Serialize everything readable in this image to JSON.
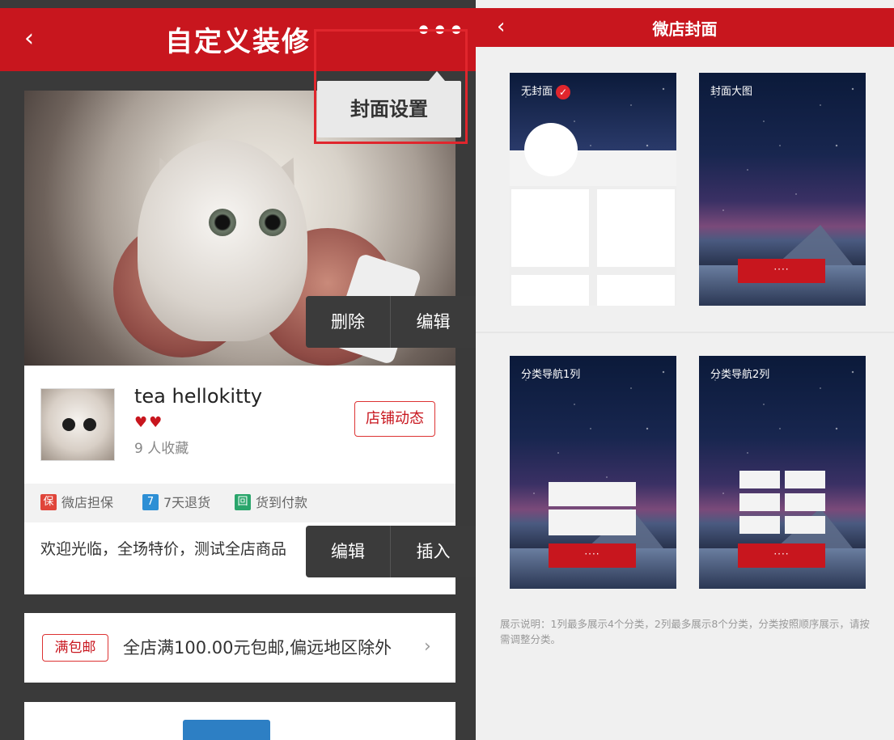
{
  "left": {
    "back_icon": "‹",
    "title": "自定义装修",
    "more_icon": "•••",
    "popup_label": "封面设置",
    "cover_actions": [
      "删除",
      "编辑"
    ],
    "shop": {
      "name": "tea hellokitty",
      "hearts": "♥♥",
      "favorites": "9 人收藏",
      "dynamic_button": "店铺动态"
    },
    "tags": [
      {
        "icon": "保",
        "label": "微店担保",
        "color": "#e0453a"
      },
      {
        "icon": "7",
        "label": "7天退货",
        "color": "#2d8fd5"
      },
      {
        "icon": "回",
        "label": "货到付款",
        "color": "#2aa56b"
      }
    ],
    "welcome": "欢迎光临，全场特价，测试全店商品",
    "desc_actions": [
      "编辑",
      "插入"
    ],
    "shipping": {
      "badge": "满包邮",
      "text": "全店满100.00元包邮,偏远地区除外",
      "chevron": "›"
    }
  },
  "right": {
    "back_icon": "‹",
    "title": "微店封面",
    "options": [
      {
        "label": "无封面",
        "selected": true
      },
      {
        "label": "封面大图",
        "selected": false,
        "button": "····"
      },
      {
        "label": "分类导航1列",
        "selected": false,
        "button": "····"
      },
      {
        "label": "分类导航2列",
        "selected": false,
        "button": "····"
      }
    ],
    "check_icon": "✓",
    "note": "展示说明：1列最多展示4个分类，2列最多展示8个分类，分类按照顺序展示，请按需调整分类。"
  },
  "colors": {
    "brand_red": "#c8161e",
    "highlight_red": "#e0262d"
  }
}
